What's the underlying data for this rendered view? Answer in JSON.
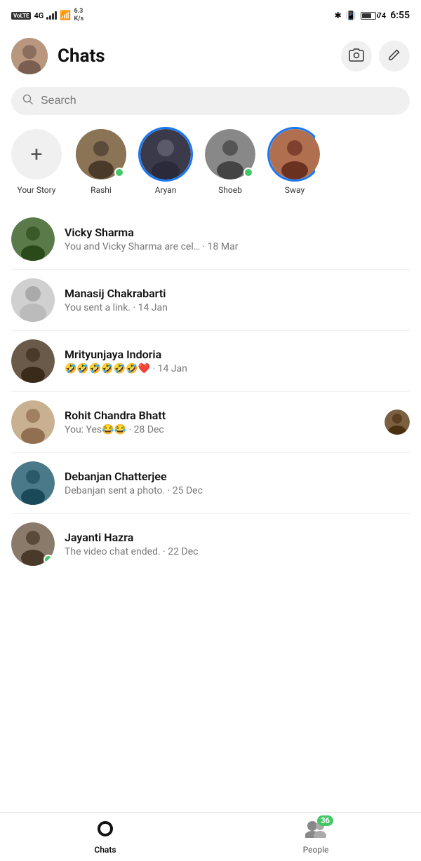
{
  "statusBar": {
    "left": {
      "volte": "VoLTE",
      "signal": "4G",
      "speed": "6.3\nK/s"
    },
    "right": {
      "battery": "74",
      "time": "6:55"
    }
  },
  "header": {
    "title": "Chats",
    "cameraBtn": "📷",
    "editBtn": "✏️"
  },
  "search": {
    "placeholder": "Search"
  },
  "stories": [
    {
      "name": "Your Story",
      "type": "add"
    },
    {
      "name": "Rashi",
      "type": "story",
      "online": true
    },
    {
      "name": "Aryan",
      "type": "ring"
    },
    {
      "name": "Shoeb",
      "type": "story",
      "online": true
    },
    {
      "name": "Sway",
      "type": "ring-partial"
    }
  ],
  "chats": [
    {
      "name": "Vicky Sharma",
      "preview": "You and Vicky Sharma are cel… · 18 Mar",
      "time": "",
      "avatarClass": "av-vicky",
      "online": false,
      "hasThumb": false
    },
    {
      "name": "Manasij Chakrabarti",
      "preview": "You sent a link. · 14 Jan",
      "time": "",
      "avatarClass": "av-manasij",
      "online": false,
      "hasThumb": false,
      "silhouette": true
    },
    {
      "name": "Mrityunjaya Indoria",
      "preview": "🤣🤣🤣🤣🤣🤣❤️ · 14 Jan",
      "time": "",
      "avatarClass": "av-mrity",
      "online": false,
      "hasThumb": false
    },
    {
      "name": "Rohit Chandra Bhatt",
      "preview": "You: Yes😂😂 · 28 Dec",
      "time": "",
      "avatarClass": "av-rohit",
      "online": false,
      "hasThumb": true
    },
    {
      "name": "Debanjan Chatterjee",
      "preview": "Debanjan sent a photo. · 25 Dec",
      "time": "",
      "avatarClass": "av-debanjan",
      "online": false,
      "hasThumb": false
    },
    {
      "name": "Jayanti Hazra",
      "preview": "The video chat ended. · 22 Dec",
      "time": "",
      "avatarClass": "av-jayanti",
      "online": true,
      "hasThumb": false
    }
  ],
  "bottomNav": {
    "chats": {
      "label": "Chats",
      "icon": "💬"
    },
    "people": {
      "label": "People",
      "icon": "👥",
      "badge": "36"
    }
  }
}
